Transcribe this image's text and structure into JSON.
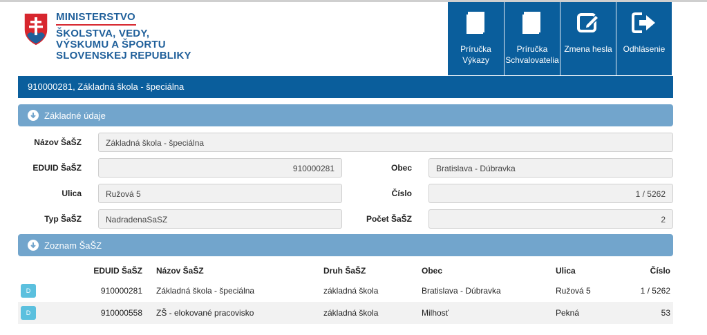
{
  "logo": {
    "line1": "MINISTERSTVO",
    "line2": "ŠKOLSTVA, VEDY,",
    "line3": "VÝSKUMU A ŠPORTU",
    "line4": "SLOVENSKEJ REPUBLIKY"
  },
  "nav": [
    {
      "label": "Príručka\nVýkazy",
      "icon": "book-icon"
    },
    {
      "label": "Príručka\nSchvalovatelia",
      "icon": "book-icon"
    },
    {
      "label": "Zmena hesla",
      "icon": "edit-icon"
    },
    {
      "label": "Odhlásenie",
      "icon": "logout-icon"
    }
  ],
  "school_bar": "910000281, Základná škola - špeciálna",
  "sections": {
    "basic": "Základné údaje",
    "list": "Zoznam ŠaŠZ"
  },
  "form": {
    "nazov_label": "Názov ŠaŠZ",
    "nazov_value": "Základná škola - špeciálna",
    "eduid_label": "EDUID ŠaŠZ",
    "eduid_value": "910000281",
    "obec_label": "Obec",
    "obec_value": "Bratislava - Dúbravka",
    "ulica_label": "Ulica",
    "ulica_value": "Ružová 5",
    "cislo_label": "Číslo",
    "cislo_value": "1 / 5262",
    "typ_label": "Typ ŠaŠZ",
    "typ_value": "NadradenaSaSZ",
    "pocet_label": "Počet ŠaŠZ",
    "pocet_value": "2"
  },
  "table": {
    "headers": [
      "EDUID ŠaŠZ",
      "Názov ŠaŠZ",
      "Druh ŠaŠZ",
      "Obec",
      "Ulica",
      "Číslo"
    ],
    "button_label": "D",
    "rows": [
      [
        "910000281",
        "Základná škola - špeciálna",
        "základná škola",
        "Bratislava - Dúbravka",
        "Ružová 5",
        "1 / 5262"
      ],
      [
        "910000558",
        "ZŠ - elokované pracovisko",
        "základná škola",
        "Milhosť",
        "Pekná",
        "53"
      ]
    ]
  },
  "colors": {
    "primary": "#0a5e9c",
    "section": "#72a5cc",
    "logo_text": "#1f5f9a",
    "detail_button": "#5bc0de"
  }
}
